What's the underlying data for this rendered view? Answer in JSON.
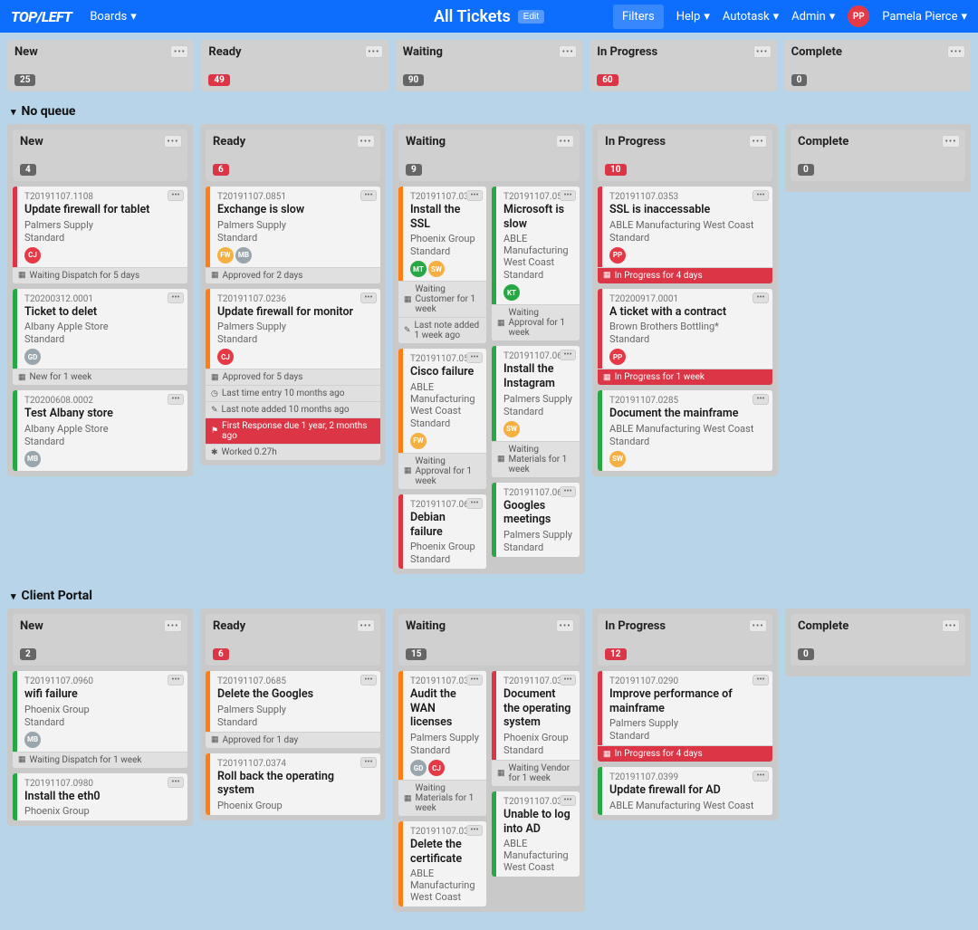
{
  "topbar": {
    "logo": "TOP/LEFT",
    "boards": "Boards",
    "title": "All Tickets",
    "edit": "Edit",
    "filters": "Filters",
    "help": "Help",
    "autotask": "Autotask",
    "admin": "Admin",
    "user_initials": "PP",
    "user_name": "Pamela Pierce"
  },
  "columns": [
    {
      "name": "New",
      "count": "25",
      "red": false
    },
    {
      "name": "Ready",
      "count": "49",
      "red": true
    },
    {
      "name": "Waiting",
      "count": "90",
      "red": false
    },
    {
      "name": "In Progress",
      "count": "60",
      "red": true
    },
    {
      "name": "Complete",
      "count": "0",
      "red": false
    }
  ],
  "sections": [
    {
      "title": "No queue",
      "lanes": {
        "new": {
          "name": "New",
          "count": "4",
          "cards": [
            {
              "id": "T20191107.1108",
              "title": "Update firewall for tablet",
              "company": "Palmers Supply",
              "priority": "Standard",
              "bar": "#dc3545",
              "avatars": [
                {
                  "t": "CJ",
                  "c": "#e63946"
                }
              ],
              "chips": [
                {
                  "t": "Waiting Dispatch for 5 days",
                  "red": false,
                  "icon": "cal"
                }
              ]
            },
            {
              "id": "T20200312.0001",
              "title": "Ticket to delet",
              "company": "Albany Apple Store",
              "priority": "Standard",
              "bar": "#28a745",
              "avatars": [
                {
                  "t": "GD",
                  "c": "#9aa6ad"
                }
              ],
              "chips": [
                {
                  "t": "New for 1 week",
                  "red": false,
                  "icon": "cal"
                }
              ]
            },
            {
              "id": "T20200608.0002",
              "title": "Test Albany store",
              "company": "Albany Apple Store",
              "priority": "Standard",
              "bar": "#28a745",
              "avatars": [
                {
                  "t": "MB",
                  "c": "#9aa6ad"
                }
              ],
              "chips": []
            }
          ]
        },
        "ready": {
          "name": "Ready",
          "count": "6",
          "red": true,
          "cards": [
            {
              "id": "T20191107.0851",
              "title": "Exchange is slow",
              "company": "Palmers Supply",
              "priority": "Standard",
              "bar": "#fd7e14",
              "avatars": [
                {
                  "t": "FW",
                  "c": "#f5b041"
                },
                {
                  "t": "MB",
                  "c": "#9aa6ad"
                }
              ],
              "chips": [
                {
                  "t": "Approved for 2 days",
                  "red": false,
                  "icon": "cal"
                }
              ]
            },
            {
              "id": "T20191107.0236",
              "title": "Update firewall for monitor",
              "company": "Palmers Supply",
              "priority": "Standard",
              "bar": "#fd7e14",
              "avatars": [
                {
                  "t": "CJ",
                  "c": "#e63946"
                }
              ],
              "chips": [
                {
                  "t": "Approved for 5 days",
                  "red": false,
                  "icon": "cal"
                },
                {
                  "t": "Last time entry 10 months ago",
                  "red": false,
                  "icon": "clock"
                },
                {
                  "t": "Last note added 10 months ago",
                  "red": false,
                  "icon": "note"
                },
                {
                  "t": "First Response due 1 year, 2 months ago",
                  "red": true,
                  "icon": "flag"
                },
                {
                  "t": "Worked 0.27h",
                  "red": false,
                  "icon": "gear"
                }
              ]
            }
          ]
        },
        "waiting": {
          "name": "Waiting",
          "count": "9",
          "left": [
            {
              "id": "T20191107.0343",
              "title": "Install the SSL",
              "company": "Phoenix Group",
              "priority": "Standard",
              "bar": "#fd7e14",
              "avatars": [
                {
                  "t": "MT",
                  "c": "#28a745"
                },
                {
                  "t": "SW",
                  "c": "#f5b041"
                }
              ],
              "chips": [
                {
                  "t": "Waiting Customer for 1 week",
                  "red": false,
                  "icon": "cal"
                },
                {
                  "t": "Last note added 1 week ago",
                  "red": false,
                  "icon": "note"
                }
              ]
            },
            {
              "id": "T20191107.0589",
              "title": "Cisco failure",
              "company": "ABLE Manufacturing West Coast",
              "priority": "Standard",
              "bar": "#fd7e14",
              "avatars": [
                {
                  "t": "FW",
                  "c": "#f5b041"
                }
              ],
              "chips": [
                {
                  "t": "Waiting Approval for 1 week",
                  "red": false,
                  "icon": "cal"
                }
              ]
            },
            {
              "id": "T20191107.0668",
              "title": "Debian failure",
              "company": "Phoenix Group",
              "priority": "Standard",
              "bar": "#dc3545",
              "avatars": [],
              "chips": []
            }
          ],
          "right": [
            {
              "id": "T20191107.0557",
              "title": "Microsoft is slow",
              "company": "ABLE Manufacturing West Coast",
              "priority": "Standard",
              "bar": "#28a745",
              "avatars": [
                {
                  "t": "KT",
                  "c": "#28a745"
                }
              ],
              "chips": [
                {
                  "t": "Waiting Approval for 1 week",
                  "red": false,
                  "icon": "cal"
                }
              ]
            },
            {
              "id": "T20191107.0623",
              "title": "Install the Instagram",
              "company": "Palmers Supply",
              "priority": "Standard",
              "bar": "#28a745",
              "avatars": [
                {
                  "t": "SW",
                  "c": "#f5b041"
                }
              ],
              "chips": [
                {
                  "t": "Waiting Materials for 1 week",
                  "red": false,
                  "icon": "cal"
                }
              ]
            },
            {
              "id": "T20191107.0678",
              "title": "Googles meetings",
              "company": "Palmers Supply",
              "priority": "Standard",
              "bar": "#28a745",
              "avatars": [],
              "chips": []
            }
          ]
        },
        "inprogress": {
          "name": "In Progress",
          "count": "10",
          "red": true,
          "cards": [
            {
              "id": "T20191107.0353",
              "title": "SSL is inaccessable",
              "company": "ABLE Manufacturing West Coast",
              "priority": "Standard",
              "bar": "#dc3545",
              "avatars": [
                {
                  "t": "PP",
                  "c": "#e63946"
                }
              ],
              "chips": [
                {
                  "t": "In Progress for 4 days",
                  "red": true,
                  "icon": "cal"
                }
              ]
            },
            {
              "id": "T20200917.0001",
              "title": "A ticket with a contract",
              "company": "Brown Brothers Bottling*",
              "priority": "Standard",
              "bar": "#dc3545",
              "avatars": [
                {
                  "t": "PP",
                  "c": "#e63946"
                }
              ],
              "chips": [
                {
                  "t": "In Progress for 1 week",
                  "red": true,
                  "icon": "cal"
                }
              ]
            },
            {
              "id": "T20191107.0285",
              "title": "Document the mainframe",
              "company": "ABLE Manufacturing West Coast",
              "priority": "Standard",
              "bar": "#28a745",
              "avatars": [
                {
                  "t": "SW",
                  "c": "#f5b041"
                }
              ],
              "chips": []
            }
          ]
        },
        "complete": {
          "name": "Complete",
          "count": "0",
          "cards": []
        }
      }
    },
    {
      "title": "Client Portal",
      "lanes": {
        "new": {
          "name": "New",
          "count": "2",
          "cards": [
            {
              "id": "T20191107.0960",
              "title": "wifi failure",
              "company": "Phoenix Group",
              "priority": "Standard",
              "bar": "#28a745",
              "avatars": [
                {
                  "t": "MB",
                  "c": "#9aa6ad"
                }
              ],
              "chips": [
                {
                  "t": "Waiting Dispatch for 1 week",
                  "red": false,
                  "icon": "cal"
                }
              ]
            },
            {
              "id": "T20191107.0980",
              "title": "Install the eth0",
              "company": "Phoenix Group",
              "priority": "",
              "bar": "#28a745",
              "avatars": [],
              "chips": []
            }
          ]
        },
        "ready": {
          "name": "Ready",
          "count": "6",
          "red": true,
          "cards": [
            {
              "id": "T20191107.0685",
              "title": "Delete the Googles",
              "company": "Palmers Supply",
              "priority": "Standard",
              "bar": "#fd7e14",
              "avatars": [],
              "chips": [
                {
                  "t": "Approved for 1 day",
                  "red": false,
                  "icon": "cal"
                }
              ]
            },
            {
              "id": "T20191107.0374",
              "title": "Roll back the operating system",
              "company": "Phoenix Group",
              "priority": "",
              "bar": "#fd7e14",
              "avatars": [],
              "chips": []
            }
          ]
        },
        "waiting": {
          "name": "Waiting",
          "count": "15",
          "left": [
            {
              "id": "T20191107.0319",
              "title": "Audit the WAN licenses",
              "company": "Palmers Supply",
              "priority": "Standard",
              "bar": "#fd7e14",
              "avatars": [
                {
                  "t": "GD",
                  "c": "#9aa6ad"
                },
                {
                  "t": "CJ",
                  "c": "#e63946"
                }
              ],
              "chips": [
                {
                  "t": "Waiting Materials for 1 week",
                  "red": false,
                  "icon": "cal"
                }
              ]
            },
            {
              "id": "T20191107.0369",
              "title": "Delete the certificate",
              "company": "ABLE Manufacturing West Coast",
              "priority": "",
              "bar": "#fd7e14",
              "avatars": [],
              "chips": []
            }
          ],
          "right": [
            {
              "id": "T20191107.0373",
              "title": "Document the operating system",
              "company": "Phoenix Group",
              "priority": "Standard",
              "bar": "#dc3545",
              "avatars": [],
              "chips": [
                {
                  "t": "Waiting Vendor for 1 week",
                  "red": false,
                  "icon": "cal"
                }
              ]
            },
            {
              "id": "T20191107.0394",
              "title": "Unable to log into AD",
              "company": "ABLE Manufacturing West Coast",
              "priority": "",
              "bar": "#28a745",
              "avatars": [],
              "chips": []
            }
          ]
        },
        "inprogress": {
          "name": "In Progress",
          "count": "12",
          "red": true,
          "cards": [
            {
              "id": "T20191107.0290",
              "title": "Improve performance of mainframe",
              "company": "Palmers Supply",
              "priority": "Standard",
              "bar": "#dc3545",
              "avatars": [],
              "chips": [
                {
                  "t": "In Progress for 4 days",
                  "red": true,
                  "icon": "cal"
                }
              ]
            },
            {
              "id": "T20191107.0399",
              "title": "Update firewall for AD",
              "company": "ABLE Manufacturing West Coast",
              "priority": "",
              "bar": "#28a745",
              "avatars": [],
              "chips": []
            }
          ]
        },
        "complete": {
          "name": "Complete",
          "count": "0",
          "cards": []
        }
      }
    }
  ],
  "icons": {
    "cal": "▦",
    "clock": "◷",
    "note": "✎",
    "flag": "⚑",
    "gear": "✱"
  }
}
